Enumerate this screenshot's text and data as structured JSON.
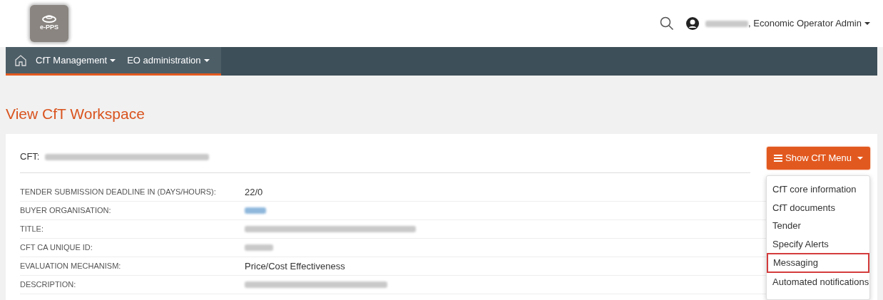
{
  "header": {
    "logo_text": "e-PPS",
    "user": {
      "name_redacted": true,
      "role": ", Economic Operator Admin"
    }
  },
  "navbar": {
    "items": [
      {
        "label": "CfT Management",
        "dropdown": true
      },
      {
        "label": "EO administration",
        "dropdown": true
      }
    ]
  },
  "page_title": "View CfT Workspace",
  "cft": {
    "prefix": "CFT:",
    "title_redacted": true
  },
  "menu_button": {
    "label": "Show CfT Menu",
    "expanded": true
  },
  "menu_items": [
    {
      "label": "CfT core information",
      "selected": false
    },
    {
      "label": "CfT documents",
      "selected": false
    },
    {
      "label": "Tender",
      "selected": false
    },
    {
      "label": "Specify Alerts",
      "selected": false
    },
    {
      "label": "Messaging",
      "selected": true
    },
    {
      "label": "Automated notifications",
      "selected": false
    }
  ],
  "fields": [
    {
      "label": "TENDER SUBMISSION DEADLINE IN (DAYS/HOURS):",
      "value": "22/0",
      "redacted": false,
      "link": false
    },
    {
      "label": "BUYER ORGANISATION:",
      "redacted": true,
      "link": true
    },
    {
      "label": "TITLE:",
      "redacted": true,
      "link": false
    },
    {
      "label": "CFT CA UNIQUE ID:",
      "redacted": true,
      "link": false
    },
    {
      "label": "EVALUATION MECHANISM:",
      "value": "Price/Cost Effectiveness",
      "redacted": false,
      "link": false
    },
    {
      "label": "DESCRIPTION:",
      "redacted": true,
      "link": false
    }
  ]
}
